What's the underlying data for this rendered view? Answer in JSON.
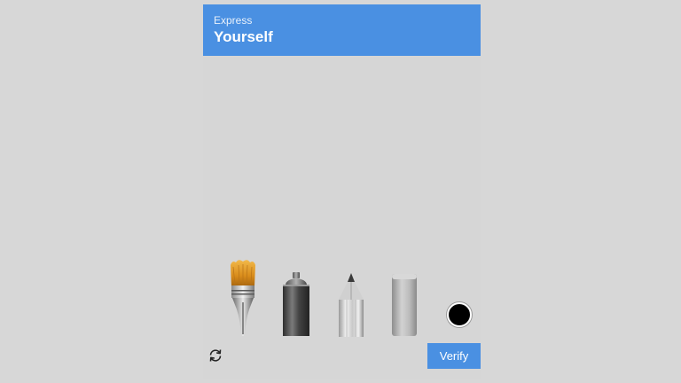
{
  "header": {
    "subtitle": "Express",
    "title": "Yourself",
    "background_color": "#4a90e2"
  },
  "tools": [
    {
      "name": "paint-brush",
      "icon": "paint-brush-icon"
    },
    {
      "name": "spray-can",
      "icon": "spray-can-icon"
    },
    {
      "name": "pencil",
      "icon": "pencil-icon"
    },
    {
      "name": "eraser",
      "icon": "eraser-icon"
    }
  ],
  "color_picker": {
    "selected_color": "#000000"
  },
  "footer": {
    "refresh_icon": "refresh-icon",
    "verify_label": "Verify",
    "verify_color": "#4a90e2"
  }
}
